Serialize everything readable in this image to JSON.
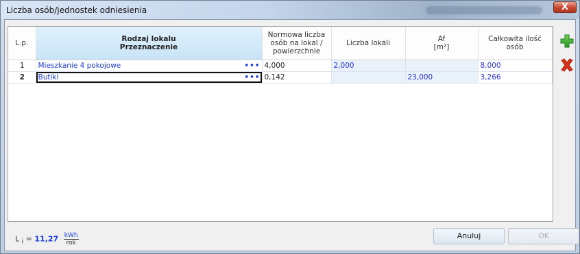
{
  "window": {
    "title": "Liczba osób/jednostek odniesienia",
    "close_label": "X"
  },
  "table": {
    "headers": {
      "lp": "L.p.",
      "rodzaj_line1": "Rodzaj lokalu",
      "rodzaj_line2": "Przeznaczenie",
      "normowa_1": "Normowa liczba",
      "normowa_2": "osób na lokal /",
      "normowa_3": "powierzchnie",
      "liczba": "Liczba lokali",
      "af_1": "Af",
      "af_2": "[m²]",
      "calkowita_1": "Całkowita ilość",
      "calkowita_2": "osób"
    },
    "rows": [
      {
        "lp": "1",
        "rodzaj": "Mieszkanie 4 pokojowe",
        "normowa": "4,000",
        "liczba": "2,000",
        "af": "",
        "calkowita": "8,000",
        "dots": "•••"
      },
      {
        "lp": "2",
        "rodzaj": "Butiki",
        "normowa": "0,142",
        "liczba": "",
        "af": "23,000",
        "calkowita": "3,266",
        "dots": "•••"
      }
    ]
  },
  "side_actions": {
    "add_icon": "green-plus-icon",
    "delete_icon": "red-x-icon",
    "add_color": "#2ea530",
    "delete_color": "#d9341b"
  },
  "footer": {
    "l_prefix": "L",
    "l_sub": "i",
    "l_eq": "=",
    "l_value": "11,27",
    "unit_num": "kWh",
    "unit_den": "rok"
  },
  "buttons": {
    "cancel": "Anuluj",
    "ok": "OK"
  }
}
